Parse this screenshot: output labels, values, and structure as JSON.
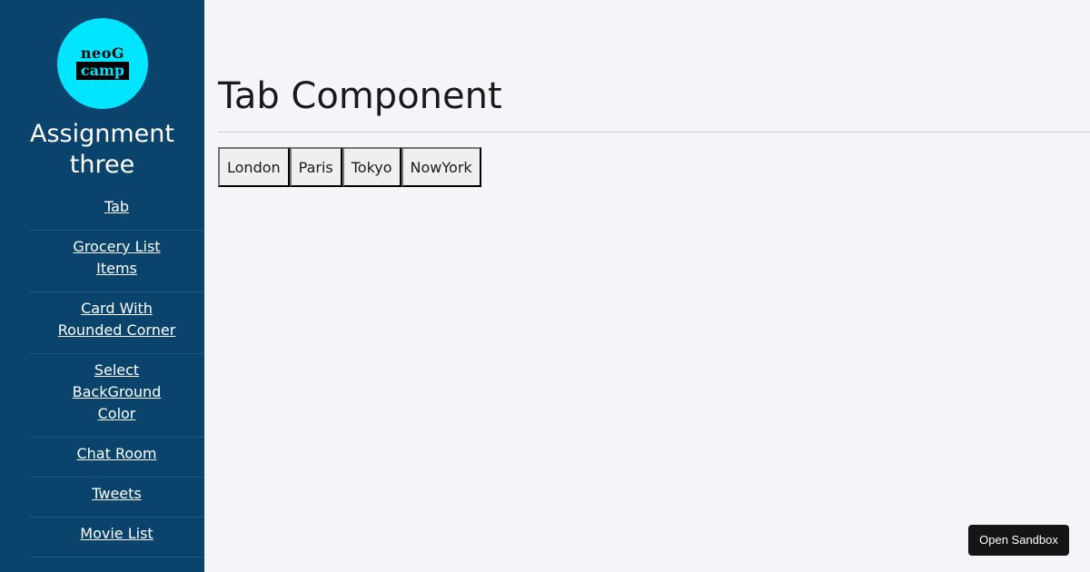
{
  "sidebar": {
    "logo": {
      "line1": "neoG",
      "line2": "camp",
      "bg_color": "#00e5ff"
    },
    "title": "Assignment three",
    "bg_color": "#0a436c",
    "items": [
      {
        "label": "Tab"
      },
      {
        "label": "Grocery List Items"
      },
      {
        "label": "Card With Rounded Corner"
      },
      {
        "label": "Select BackGround Color"
      },
      {
        "label": "Chat Room"
      },
      {
        "label": "Tweets"
      },
      {
        "label": "Movie List"
      }
    ]
  },
  "main": {
    "title": "Tab Component",
    "tabs": [
      {
        "label": "London"
      },
      {
        "label": "Paris"
      },
      {
        "label": "Tokyo"
      },
      {
        "label": "NowYork"
      }
    ]
  },
  "sandbox_button": {
    "label": "Open Sandbox"
  }
}
